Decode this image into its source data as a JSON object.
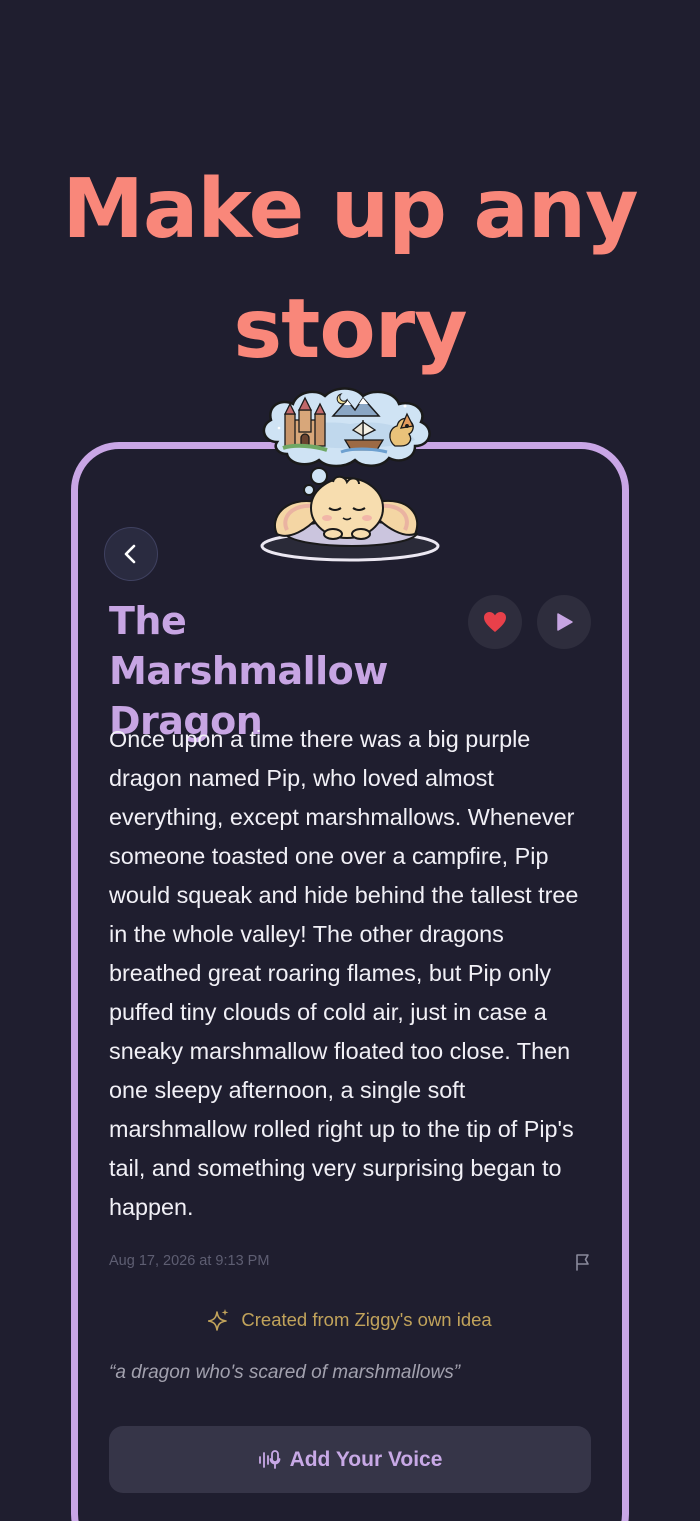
{
  "headline": {
    "line1": "Make up any",
    "line2": "story"
  },
  "story": {
    "title_line1": "The Marshmallow",
    "title_line2": "Dragon",
    "body": "Once upon a time there was a big purple dragon named Pip, who loved almost everything, except marshmallows. Whenever someone toasted one over a campfire, Pip would squeak and hide behind the tallest tree in the whole valley! The other dragons breathed great roaring flames, but Pip only puffed tiny clouds of cold air, just in case a sneaky marshmallow floated too close. Then one sleepy afternoon, a single soft marshmallow rolled right up to the tip of Pip's tail, and something very surprising began to happen.",
    "timestamp": "Aug 17, 2026 at 9:13 PM",
    "created_from": "Created from Ziggy's own idea",
    "prompt_quote": "“a dragon who's scared of marshmallows”"
  },
  "actions": {
    "add_voice_label": "Add Your Voice"
  },
  "icons": {
    "back": "chevron-left-icon",
    "favorite": "heart-icon",
    "play": "play-icon",
    "report": "flag-icon",
    "sparkle": "sparkle-icon",
    "voice": "voice-waveform-icon"
  },
  "colors": {
    "background": "#1f1e2f",
    "headline": "#f9877a",
    "accent_lavender": "#c7a5e3",
    "heart": "#e8404a",
    "gold": "#c1a35b"
  }
}
